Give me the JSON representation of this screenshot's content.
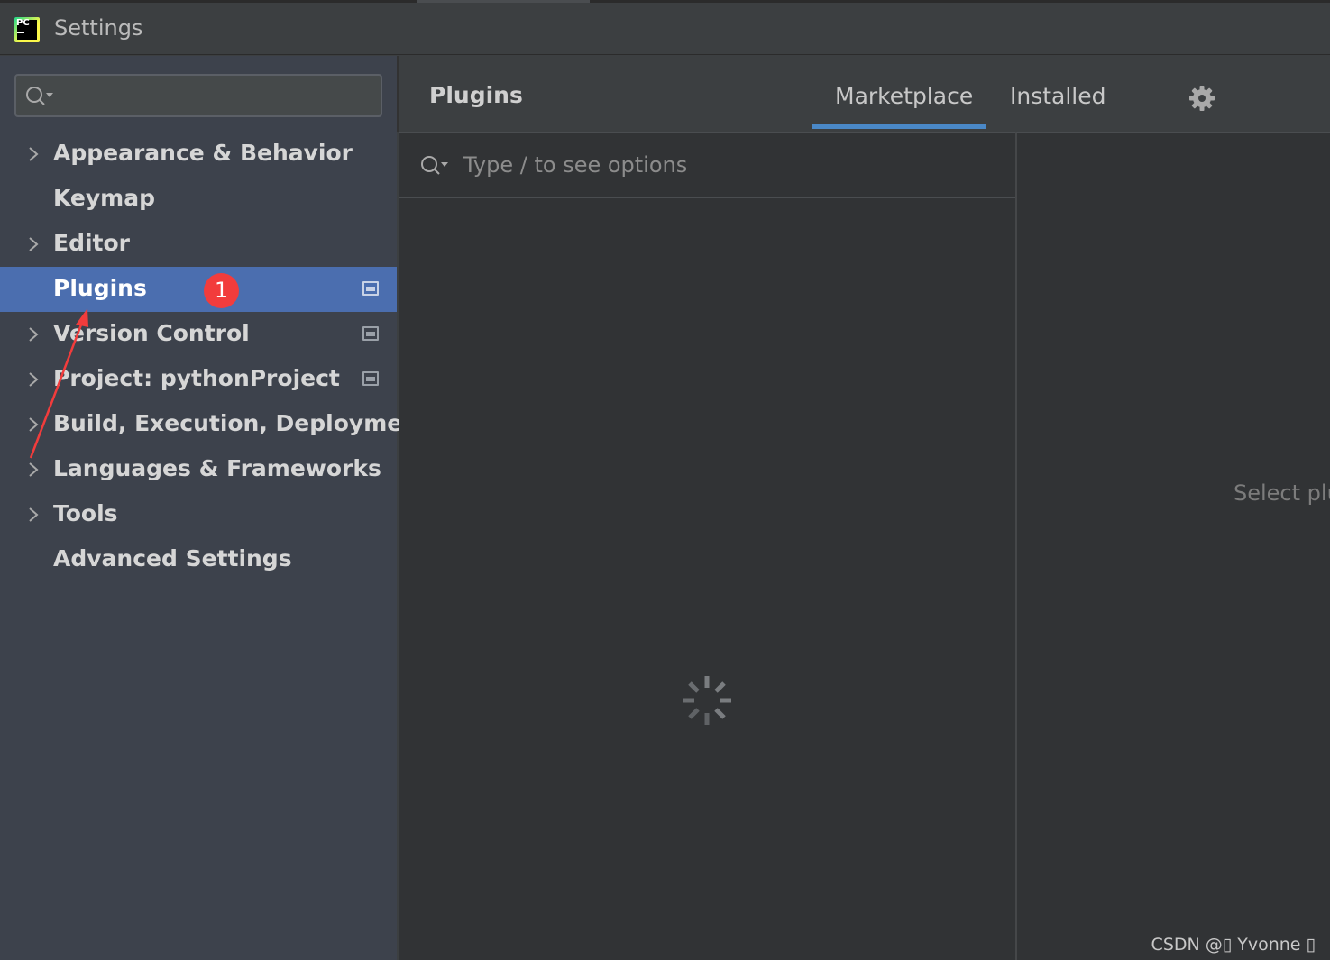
{
  "window": {
    "title": "Settings",
    "logo_text": "PC"
  },
  "sidebar": {
    "search_placeholder": "",
    "items": [
      {
        "label": "Appearance & Behavior",
        "expandable": true,
        "selected": false,
        "has_scope_icon": false
      },
      {
        "label": "Keymap",
        "expandable": false,
        "selected": false,
        "has_scope_icon": false
      },
      {
        "label": "Editor",
        "expandable": true,
        "selected": false,
        "has_scope_icon": false
      },
      {
        "label": "Plugins",
        "expandable": false,
        "selected": true,
        "has_scope_icon": true
      },
      {
        "label": "Version Control",
        "expandable": true,
        "selected": false,
        "has_scope_icon": true
      },
      {
        "label": "Project: pythonProject",
        "expandable": true,
        "selected": false,
        "has_scope_icon": true
      },
      {
        "label": "Build, Execution, Deployment",
        "expandable": true,
        "selected": false,
        "has_scope_icon": false
      },
      {
        "label": "Languages & Frameworks",
        "expandable": true,
        "selected": false,
        "has_scope_icon": false
      },
      {
        "label": "Tools",
        "expandable": true,
        "selected": false,
        "has_scope_icon": false
      },
      {
        "label": "Advanced Settings",
        "expandable": false,
        "selected": false,
        "has_scope_icon": false
      }
    ]
  },
  "annotation": {
    "badge_number": "1",
    "color": "#f23c3c"
  },
  "content": {
    "title": "Plugins",
    "tabs": [
      {
        "label": "Marketplace",
        "active": true
      },
      {
        "label": "Installed",
        "active": false
      }
    ],
    "settings_icon": "gear-icon",
    "search_placeholder": "Type / to see options",
    "loading": true,
    "detail_hint": "Select plu"
  },
  "watermark": "CSDN @▯ Yvonne ▯",
  "colors": {
    "selection": "#4b6eaf",
    "tab_underline": "#4a88c7",
    "sidebar_bg": "#3d424c",
    "content_bg": "#313335"
  }
}
